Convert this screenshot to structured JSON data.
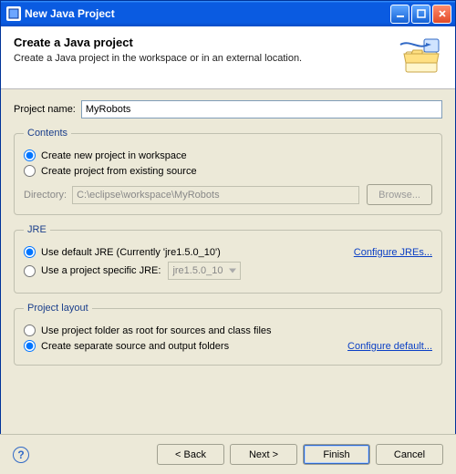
{
  "window": {
    "title": "New Java Project"
  },
  "banner": {
    "heading": "Create a Java project",
    "subtext": "Create a Java project in the workspace or in an external location."
  },
  "project": {
    "name_label": "Project name:",
    "name_value": "MyRobots"
  },
  "contents": {
    "legend": "Contents",
    "opt_new": "Create new project in workspace",
    "opt_existing": "Create project from existing source",
    "selected": "new",
    "directory_label": "Directory:",
    "directory_value": "C:\\eclipse\\workspace\\MyRobots",
    "browse_label": "Browse..."
  },
  "jre": {
    "legend": "JRE",
    "opt_default": "Use default JRE (Currently 'jre1.5.0_10')",
    "opt_specific": "Use a project specific JRE:",
    "selected": "default",
    "specific_value": "jre1.5.0_10",
    "configure_label": "Configure JREs..."
  },
  "layout": {
    "legend": "Project layout",
    "opt_root": "Use project folder as root for sources and class files",
    "opt_separate": "Create separate source and output folders",
    "selected": "separate",
    "configure_label": "Configure default..."
  },
  "footer": {
    "back": "< Back",
    "next": "Next >",
    "finish": "Finish",
    "cancel": "Cancel"
  }
}
